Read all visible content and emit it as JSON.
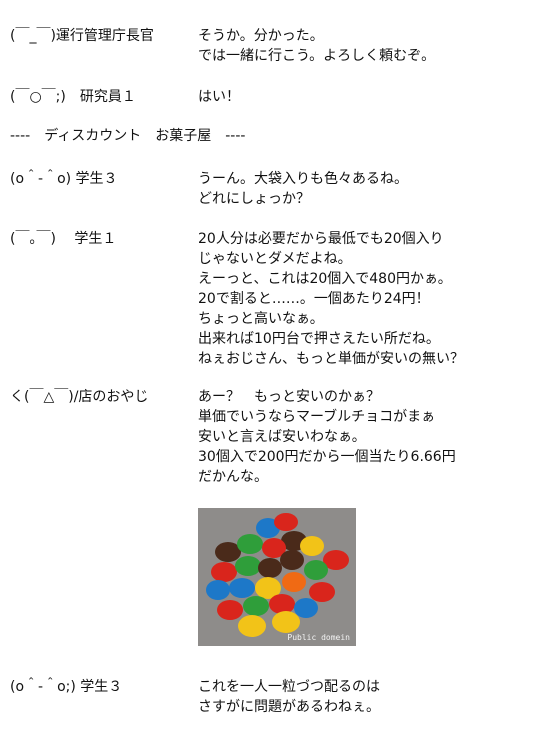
{
  "dialogue": [
    {
      "speaker": "(￣_￣)運行管理庁長官",
      "lines": [
        "そうか。分かった。",
        "では一緒に行こう。よろしく頼むぞ。"
      ]
    },
    {
      "speaker": "(￣○￣;)　研究員１",
      "lines": [
        "はい！"
      ]
    },
    {
      "speaker": "(o＾-＾o) 学生３",
      "lines": [
        "うーん。大袋入りも色々あるね。",
        "どれにしょっか？"
      ]
    },
    {
      "speaker": "(￣｡￣)　 学生１",
      "lines": [
        "20人分は必要だから最低でも20個入り",
        "じゃないとダメだよね。",
        "えーっと、これは20個入で480円かぁ。",
        "20で割ると……。一個あたり24円！",
        "ちょっと高いなぁ。",
        "出来れば10円台で押さえたい所だね。",
        "ねぇおじさん、もっと単価が安いの無い？"
      ]
    },
    {
      "speaker": "く(￣△￣)/店のおやじ",
      "lines": [
        "あー？　もっと安いのかぁ？",
        "単価でいうならマーブルチョコがまぁ",
        "安いと言えば安いわなぁ。",
        "30個入で200円だから一個当たり6.66円",
        "だかんな。"
      ]
    },
    {
      "speaker": "(o＾-＾o;) 学生３",
      "lines": [
        "これを一人一粒づつ配るのは",
        "さすがに問題があるわねぇ。"
      ]
    }
  ],
  "scene_heading": "----　ディスカウント　お菓子屋　----",
  "photo": {
    "caption": "Public domein",
    "background": "#8e8c8a",
    "candy_colors": [
      "#d9251c",
      "#f2c318",
      "#1d78c8",
      "#2f9e3a",
      "#f06a14",
      "#4a2a1a"
    ]
  }
}
